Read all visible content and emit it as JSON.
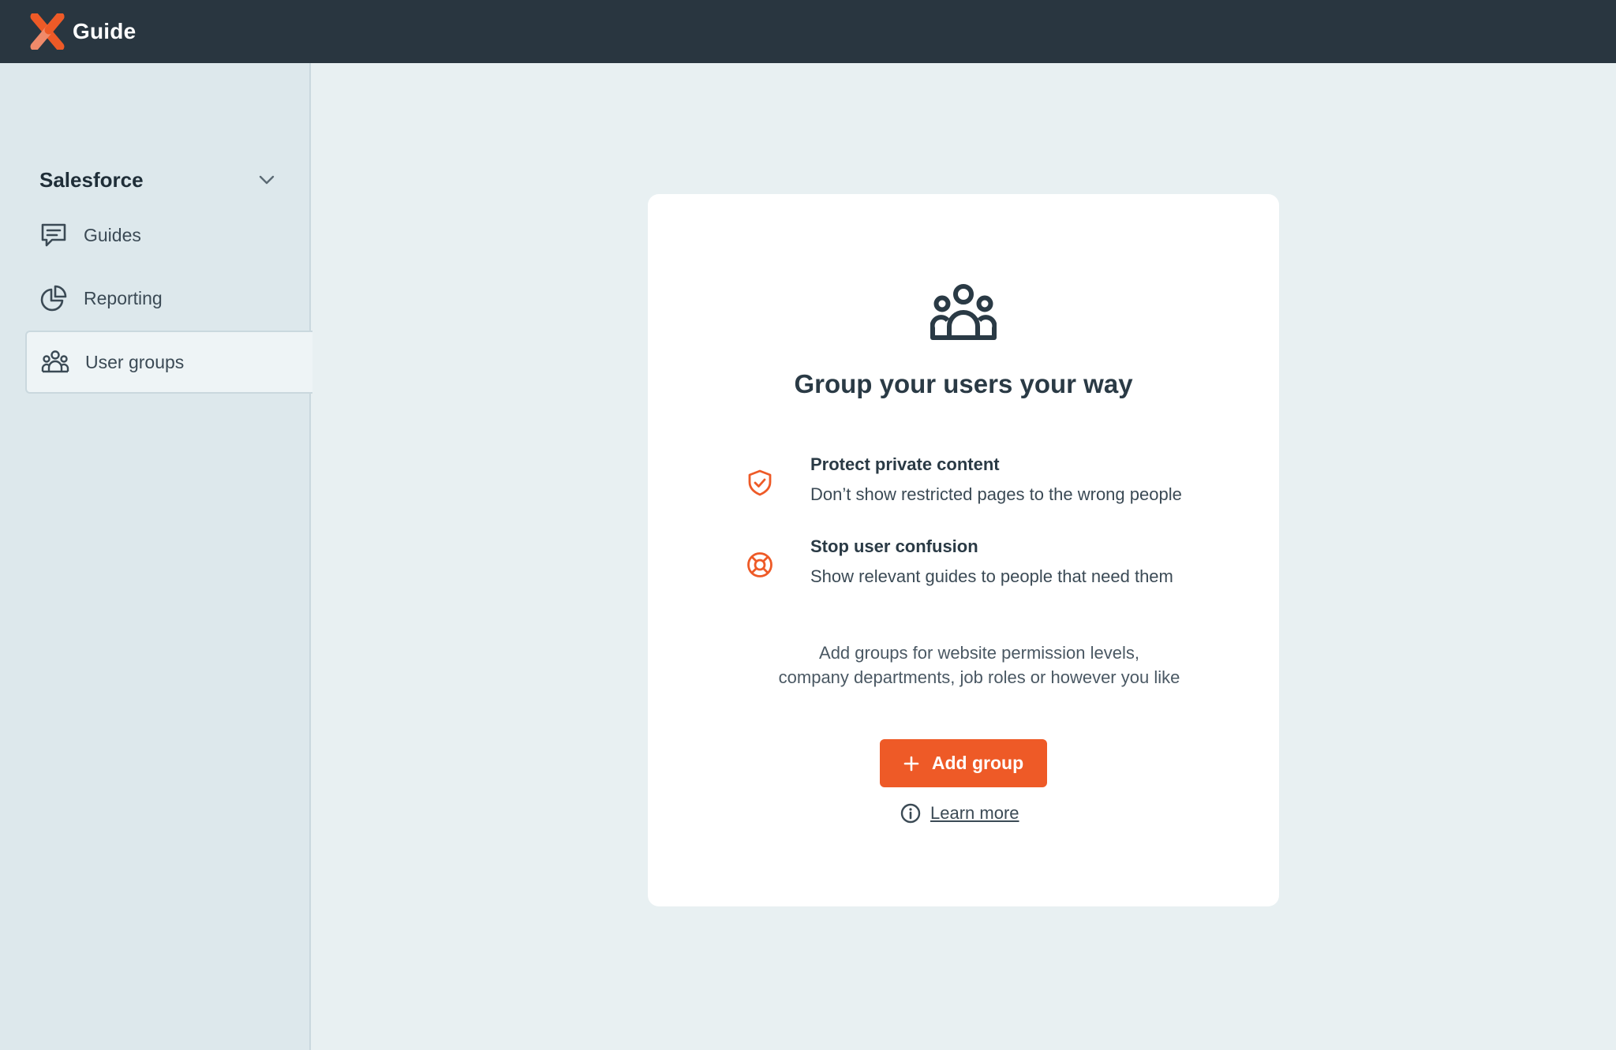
{
  "header": {
    "app_title": "Guide",
    "logo_icon": "x-logo-icon"
  },
  "sidebar": {
    "workspace": "Salesforce",
    "items": [
      {
        "label": "Guides",
        "icon": "message-icon",
        "active": false
      },
      {
        "label": "Reporting",
        "icon": "pie-chart-icon",
        "active": false
      },
      {
        "label": "User groups",
        "icon": "users-icon",
        "active": true
      }
    ]
  },
  "main": {
    "empty_state": {
      "heading": "Group your users your way",
      "benefits": [
        {
          "title": "Protect private content",
          "description": "Don’t show restricted pages to the wrong people",
          "icon": "shield-check-icon"
        },
        {
          "title": "Stop user confusion",
          "description": "Show relevant guides to people that need them",
          "icon": "lifebuoy-icon"
        }
      ],
      "note_line1": "Add groups for website permission levels,",
      "note_line2": "company departments, job roles or however you like",
      "add_button": "Add group",
      "learn_more": "Learn more"
    }
  },
  "colors": {
    "topbar": "#293640",
    "accent": "#ee5a27",
    "background": "#e8f0f2",
    "sidebar": "#dde8ec"
  }
}
